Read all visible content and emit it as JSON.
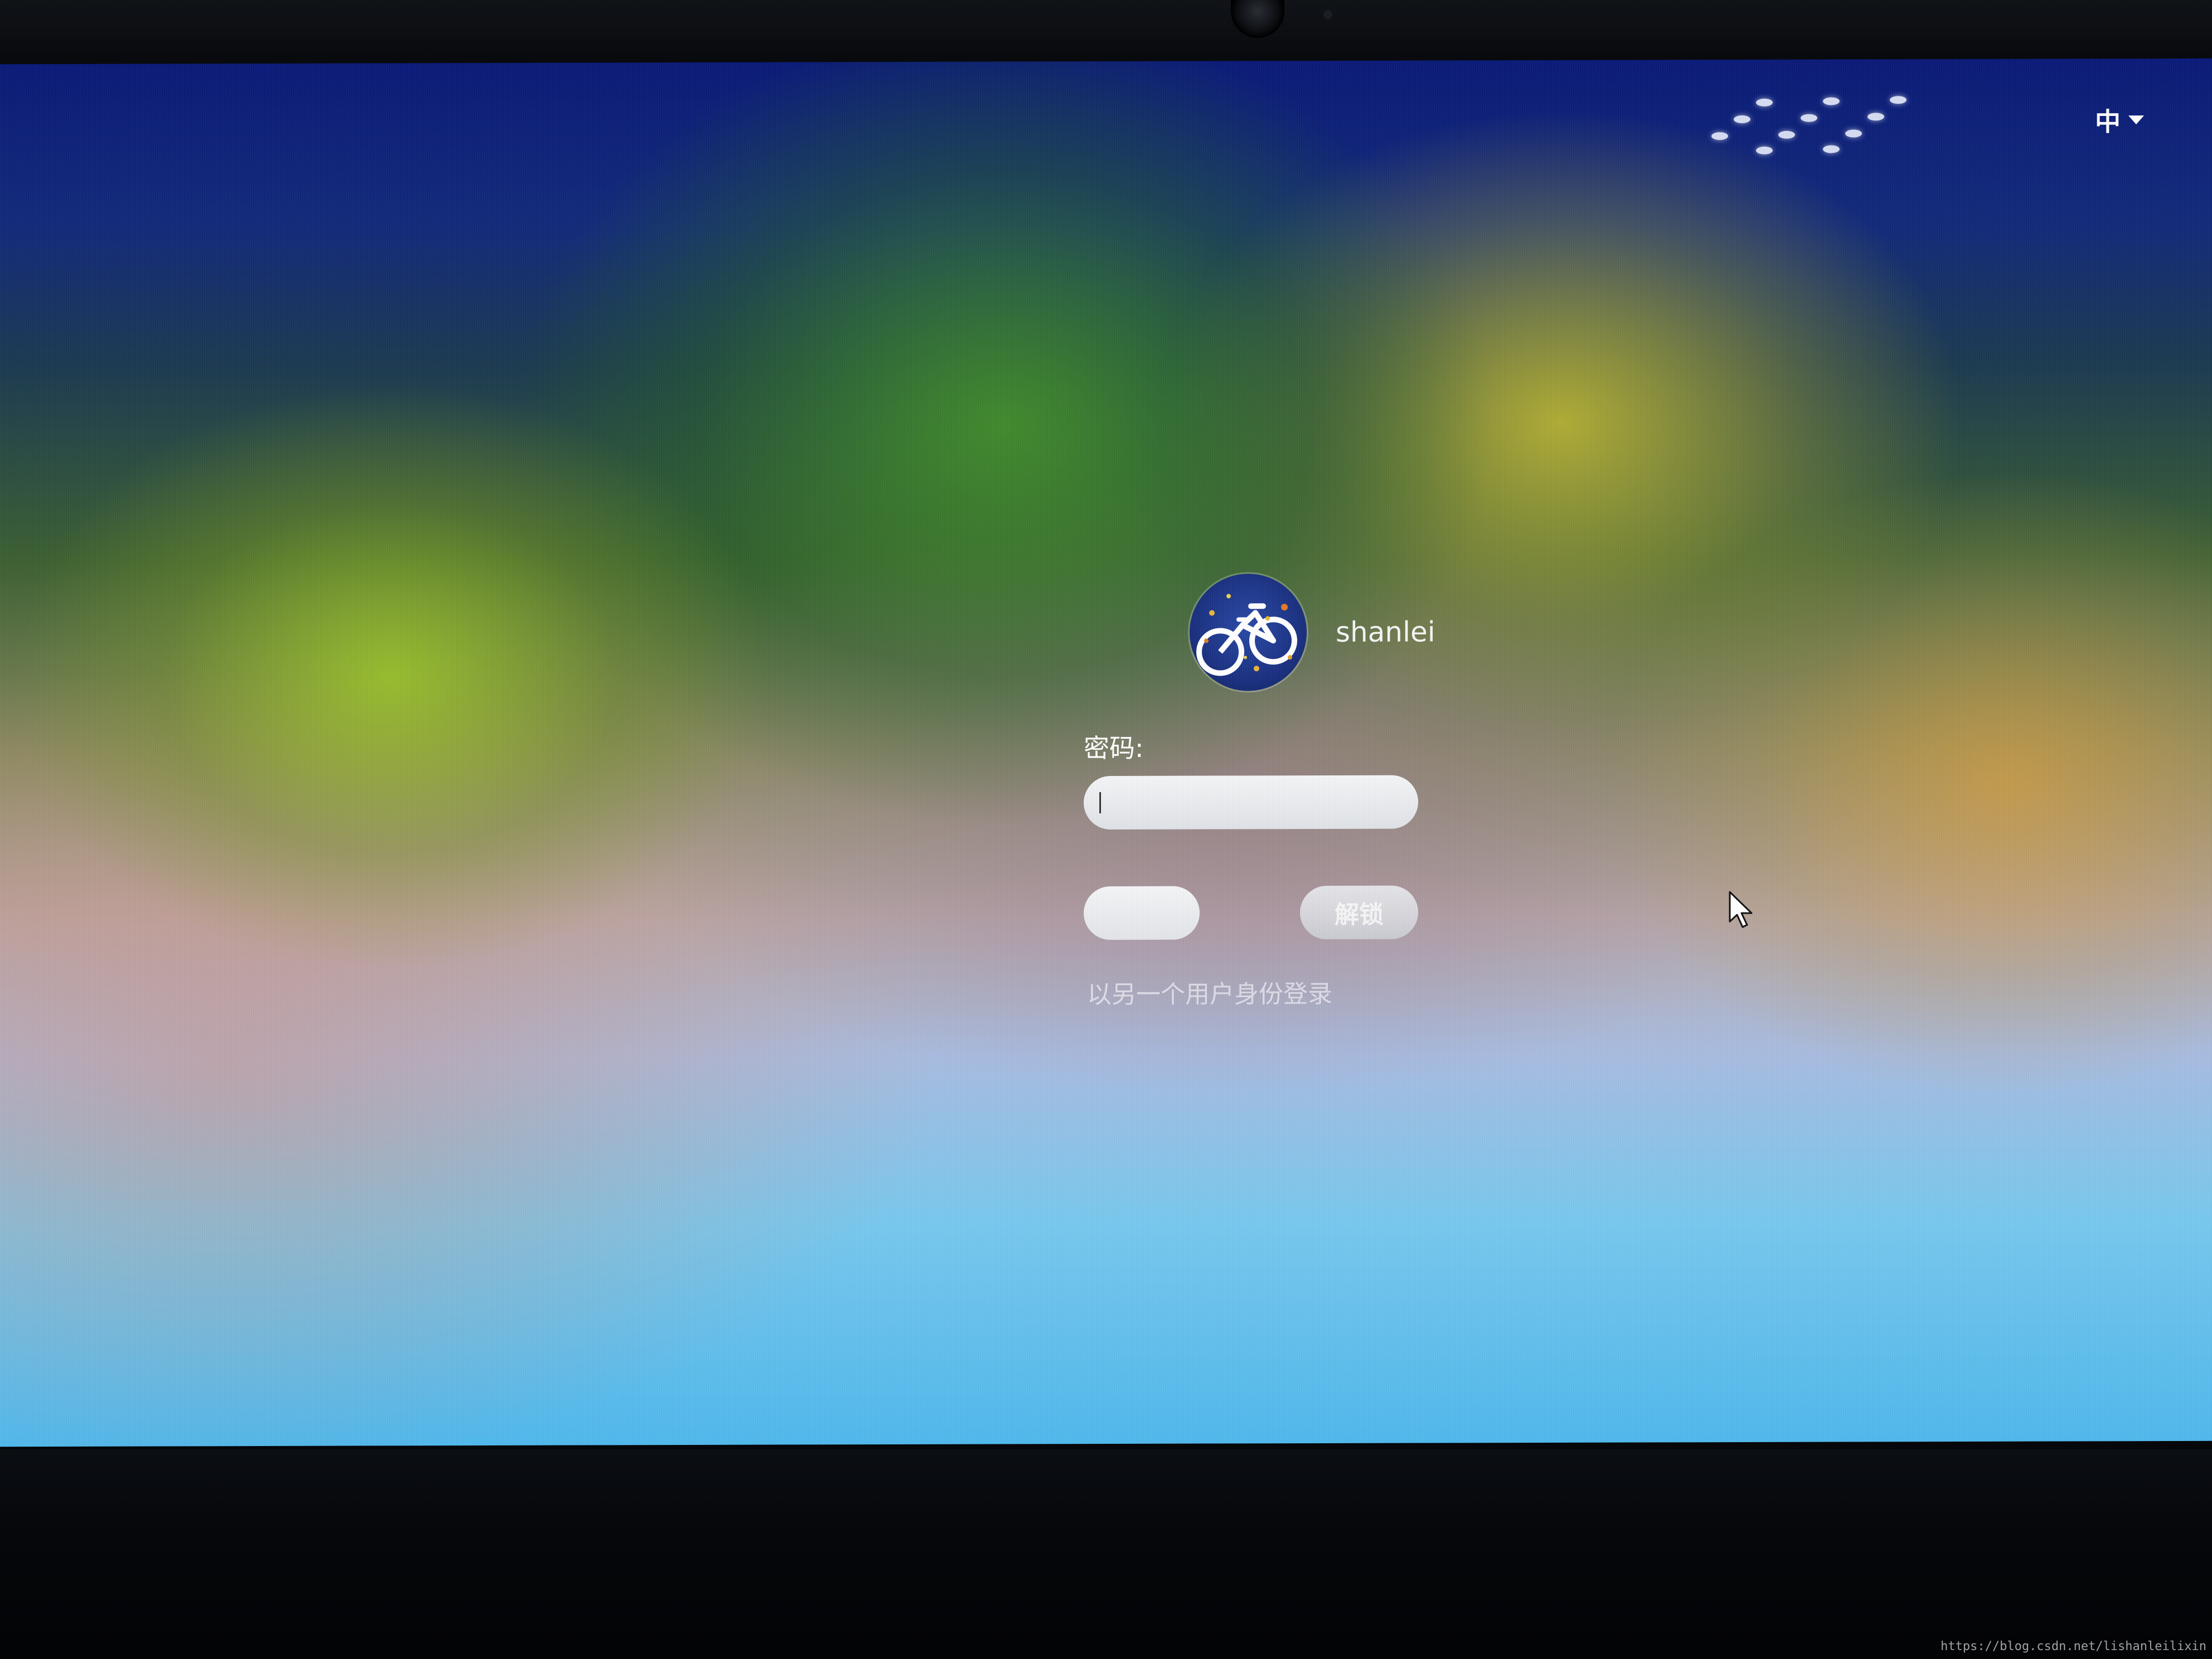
{
  "top_bar": {
    "input_method": "中",
    "input_method_icon": "chevron-down-icon"
  },
  "user": {
    "name": "shanlei",
    "avatar_icon": "bicycle-icon"
  },
  "password": {
    "label": "密码:",
    "value": ""
  },
  "actions": {
    "left_button_label": "",
    "unlock_label": "解锁",
    "switch_user_link": "以另一个用户身份登录"
  },
  "cursor": {
    "icon": "mouse-pointer-icon"
  },
  "watermark": {
    "text": "https://blog.csdn.net/lishanleilixin"
  },
  "colors": {
    "field_background": "#e6e8eb",
    "text": "#ffffff"
  }
}
